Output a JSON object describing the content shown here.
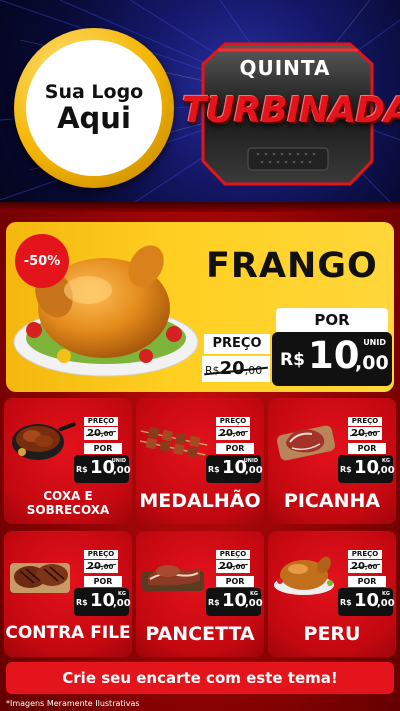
{
  "header": {
    "logo_line1": "Sua Logo",
    "logo_line2": "Aqui",
    "badge_line1": "QUINTA",
    "badge_line2": "TURBINADA"
  },
  "featured": {
    "discount": "-50%",
    "title": "FRANGO",
    "old_label": "PREÇO",
    "old_currency": "R$",
    "old_price": "20",
    "old_cents": ",00",
    "new_label": "POR",
    "currency": "R$",
    "price": "10",
    "cents": ",00",
    "unit": "UNID"
  },
  "products": [
    {
      "name": "COXA E SOBRECOXA",
      "unit": "UNID",
      "old_label": "PREÇO",
      "old_currency": "R$",
      "old_price": "20",
      "old_cents": ",00",
      "new_label": "POR",
      "currency": "R$",
      "price": "10",
      "cents": ",00",
      "icon": "pan-icon"
    },
    {
      "name": "MEDALHÃO",
      "unit": "UNID",
      "old_label": "PREÇO",
      "old_currency": "R$",
      "old_price": "20",
      "old_cents": ",00",
      "new_label": "POR",
      "currency": "R$",
      "price": "10",
      "cents": ",00",
      "icon": "skewer-icon"
    },
    {
      "name": "PICANHA",
      "unit": "KG",
      "old_label": "PREÇO",
      "old_currency": "R$",
      "old_price": "20",
      "old_cents": ",00",
      "new_label": "POR",
      "currency": "R$",
      "price": "10",
      "cents": ",00",
      "icon": "steak-board-icon"
    },
    {
      "name": "CONTRA FILE",
      "unit": "KG",
      "old_label": "PREÇO",
      "old_currency": "R$",
      "old_price": "20",
      "old_cents": ",00",
      "new_label": "POR",
      "currency": "R$",
      "price": "10",
      "cents": ",00",
      "icon": "grilled-steak-icon"
    },
    {
      "name": "PANCETTA",
      "unit": "KG",
      "old_label": "PREÇO",
      "old_currency": "R$",
      "old_price": "20",
      "old_cents": ",00",
      "new_label": "POR",
      "currency": "R$",
      "price": "10",
      "cents": ",00",
      "icon": "pancetta-icon"
    },
    {
      "name": "PERU",
      "unit": "KG",
      "old_label": "PREÇO",
      "old_currency": "R$",
      "old_price": "20",
      "old_cents": ",00",
      "new_label": "POR",
      "currency": "R$",
      "price": "10",
      "cents": ",00",
      "icon": "turkey-icon"
    }
  ],
  "footer": {
    "cta": "Crie seu encarte com este tema!",
    "disclaimer": "*Imagens Meramente Ilustrativas"
  },
  "colors": {
    "accent_red": "#e3141b",
    "yellow": "#ffd022",
    "navy": "#15186a",
    "gold": "#f3b400"
  }
}
